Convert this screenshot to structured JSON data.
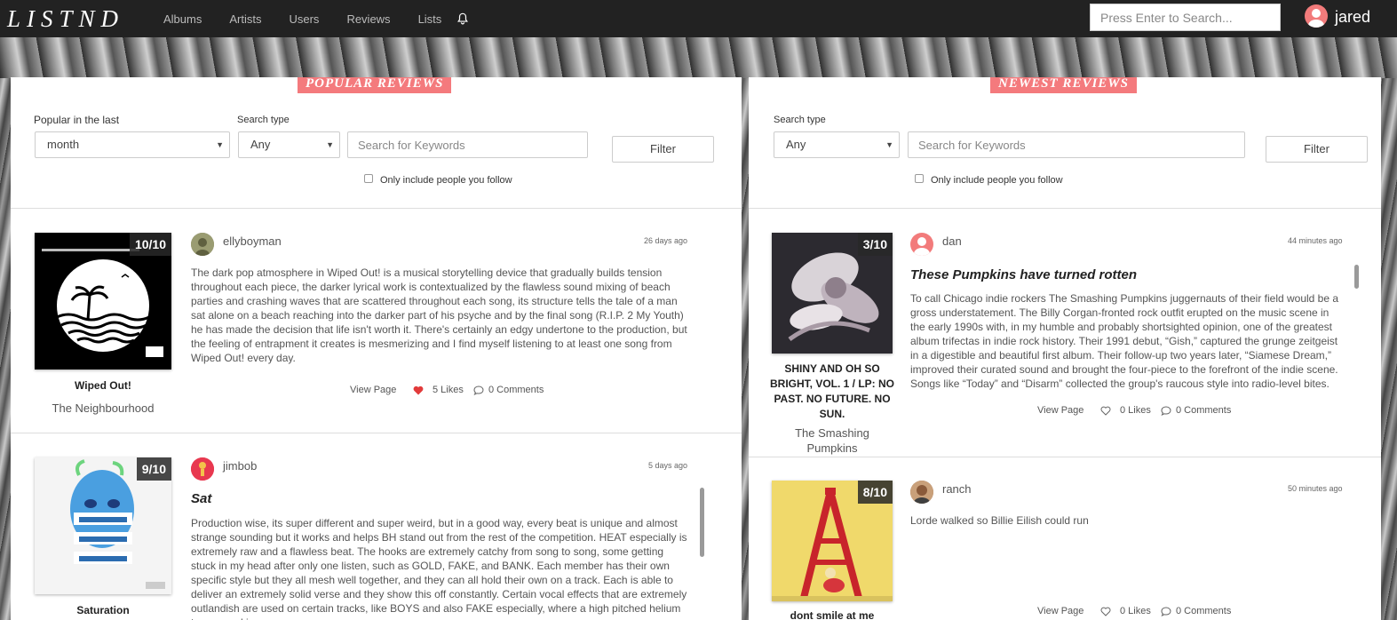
{
  "app": {
    "logo": "LISTND"
  },
  "nav": {
    "items": [
      "Albums",
      "Artists",
      "Users",
      "Reviews",
      "Lists"
    ]
  },
  "search": {
    "placeholder": "Press Enter to Search..."
  },
  "user": {
    "name": "jared"
  },
  "popular": {
    "title": "POPULAR REVIEWS",
    "period_label": "Popular in the last",
    "period_value": "month",
    "search_type_label": "Search type",
    "search_type_value": "Any",
    "keyword_placeholder": "Search for Keywords",
    "filter_label": "Filter",
    "follow_label": "Only include people you follow",
    "reviews": [
      {
        "score": "10/10",
        "album": "Wiped Out!",
        "artist": "The Neighbourhood",
        "user": "ellyboyman",
        "time": "26 days ago",
        "title": "",
        "body": "The dark pop atmosphere in Wiped Out! is a musical storytelling device that gradually builds tension throughout each piece, the darker lyrical work is contextualized by the flawless sound mixing of beach parties and crashing waves that are scattered throughout each song, its structure tells the tale of a man sat alone on a beach reaching into the darker part of his psyche and by the final song (R.I.P. 2 My Youth) he has made the decision that life isn't worth it. There's certainly an edgy undertone to the production, but the feeling of entrapment it creates is mesmerizing and I find myself listening to at least one song from Wiped Out! every day.",
        "view": "View Page",
        "likes": "5 Likes",
        "comments": "0 Comments"
      },
      {
        "score": "9/10",
        "album": "Saturation",
        "artist": "",
        "user": "jimbob",
        "time": "5 days ago",
        "title": "Sat",
        "body": "Production wise, its super different and super weird, but in a good way, every beat is unique and almost strange sounding but it works and helps BH stand out from the rest of the competition. HEAT especially is extremely raw and a flawless beat. The hooks are extremely catchy from song to song, some getting stuck in my head after only one listen, such as GOLD, FAKE, and BANK. Each member has their own specific style but they all mesh well together, and they can all hold their own on a track. Each is able to deliver an extremely solid verse and they show this off constantly. Certain vocal effects that are extremely outlandish are used on certain tracks, like BOYS and also FAKE especially, where a high pitched helium type sound is"
      }
    ]
  },
  "newest": {
    "title": "NEWEST REVIEWS",
    "search_type_label": "Search type",
    "search_type_value": "Any",
    "keyword_placeholder": "Search for Keywords",
    "filter_label": "Filter",
    "follow_label": "Only include people you follow",
    "reviews": [
      {
        "score": "3/10",
        "album": "SHINY AND OH SO BRIGHT, VOL. 1 / LP: NO PAST. NO FUTURE. NO SUN.",
        "artist": "The Smashing Pumpkins",
        "user": "dan",
        "time": "44 minutes ago",
        "title": "These Pumpkins have turned rotten",
        "body": "To call Chicago indie rockers The Smashing Pumpkins juggernauts of their field would be a gross understatement. The Billy Corgan-fronted rock outfit erupted on the music scene in the early 1990s with, in my humble and probably shortsighted opinion, one of the greatest album trifectas in indie rock history. Their 1991 debut, “Gish,” captured the grunge zeitgeist in a digestible and beautiful first album. Their follow-up two years later, “Siamese Dream,” improved their curated sound and brought the four-piece to the forefront of the indie scene. Songs like “Today” and “Disarm” collected the group's raucous style into radio-level bites.",
        "view": "View Page",
        "likes": "0 Likes",
        "comments": "0 Comments"
      },
      {
        "score": "8/10",
        "album": "dont smile at me",
        "artist": "",
        "user": "ranch",
        "time": "50 minutes ago",
        "title": "",
        "body": "Lorde walked so Billie Eilish could run",
        "view": "View Page",
        "likes": "0 Likes",
        "comments": "0 Comments"
      }
    ]
  },
  "colors": {
    "accent": "#f47a7d",
    "heart_liked": "#e23b3b",
    "nav_bg": "#222222"
  },
  "icons": [
    "bell-icon",
    "heart-icon",
    "comment-icon",
    "caret-down-icon",
    "user-avatar-icon"
  ]
}
